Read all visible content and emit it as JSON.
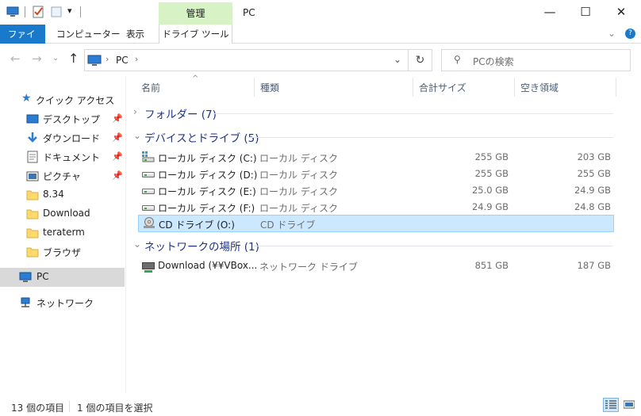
{
  "window": {
    "title": "PC",
    "context_group": "管理",
    "controls": {
      "minimize": "—",
      "maximize": "☐",
      "close": "✕"
    }
  },
  "ribbon": {
    "tabs": [
      "ファイル",
      "コンピューター",
      "表示",
      "ドライブ ツール"
    ],
    "active_tab_color": "#1979ca",
    "context_color": "#d7f2c5"
  },
  "nav": {
    "breadcrumb": [
      "PC"
    ],
    "search_placeholder": "PCの検索"
  },
  "sidebar": {
    "quick_access": "クイック アクセス",
    "items": [
      {
        "label": "デスクトップ",
        "icon": "desktop-icon",
        "pinned": true
      },
      {
        "label": "ダウンロード",
        "icon": "download-icon",
        "pinned": true
      },
      {
        "label": "ドキュメント",
        "icon": "document-icon",
        "pinned": true
      },
      {
        "label": "ピクチャ",
        "icon": "picture-icon",
        "pinned": true
      },
      {
        "label": "8.34",
        "icon": "folder-icon",
        "pinned": false
      },
      {
        "label": "Download",
        "icon": "folder-icon",
        "pinned": false
      },
      {
        "label": "teraterm",
        "icon": "folder-icon",
        "pinned": false
      },
      {
        "label": "ブラウザ",
        "icon": "folder-icon",
        "pinned": false
      }
    ],
    "pc": "PC",
    "network": "ネットワーク"
  },
  "columns": [
    "名前",
    "種類",
    "合計サイズ",
    "空き領域"
  ],
  "groups": {
    "folders": "フォルダー (7)",
    "devices": "デバイスとドライブ (5)",
    "network": "ネットワークの場所 (1)"
  },
  "drives": [
    {
      "name": "ローカル ディスク (C:)",
      "type": "ローカル ディスク",
      "total": "255 GB",
      "free": "203 GB",
      "icon": "windows-drive-icon"
    },
    {
      "name": "ローカル ディスク (D:)",
      "type": "ローカル ディスク",
      "total": "255 GB",
      "free": "255 GB",
      "icon": "drive-icon"
    },
    {
      "name": "ローカル ディスク (E:)",
      "type": "ローカル ディスク",
      "total": "25.0 GB",
      "free": "24.9 GB",
      "icon": "drive-icon"
    },
    {
      "name": "ローカル ディスク (F:)",
      "type": "ローカル ディスク",
      "total": "24.9 GB",
      "free": "24.8 GB",
      "icon": "drive-icon"
    },
    {
      "name": "CD ドライブ (O:)",
      "type": "CD ドライブ",
      "total": "",
      "free": "",
      "icon": "cd-drive-icon",
      "selected": true
    }
  ],
  "network_locations": [
    {
      "name": "Download (¥¥VBox...",
      "type": "ネットワーク ドライブ",
      "total": "851 GB",
      "free": "187 GB",
      "icon": "network-drive-icon"
    }
  ],
  "status": {
    "count": "13 個の項目",
    "selection": "1 個の項目を選択"
  }
}
